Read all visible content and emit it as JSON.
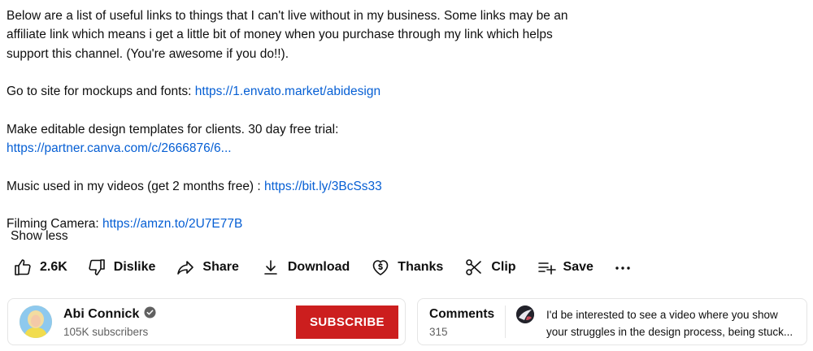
{
  "description": {
    "intro": "Below are a list of useful links to things that I can't live without in my business. Some links may be an affiliate link which means i get a little bit of money when you purchase through my link which helps support this channel. (You're awesome if you do!!).",
    "mockups_label": "Go to site for mockups and fonts: ",
    "mockups_link": "https://1.envato.market/abidesign",
    "templates_label": "Make editable design templates for clients. 30 day free trial:",
    "templates_link": "https://partner.canva.com/c/2666876/6...",
    "music_label": "Music used in my videos (get 2 months free) : ",
    "music_link": "https://bit.ly/3BcSs33",
    "camera_label": "Filming Camera: ",
    "camera_link": "https://amzn.to/2U7E77B",
    "show_less": "Show less"
  },
  "actions": {
    "like_count": "2.6K",
    "dislike": "Dislike",
    "share": "Share",
    "download": "Download",
    "thanks": "Thanks",
    "clip": "Clip",
    "save": "Save"
  },
  "channel": {
    "name": "Abi Connick",
    "subscribers": "105K subscribers",
    "subscribe_label": "SUBSCRIBE"
  },
  "comments": {
    "title": "Comments",
    "count": "315",
    "preview_line1": "I'd be interested to see a video where you show",
    "preview_line2": "your struggles in the design process, being stuck..."
  },
  "colors": {
    "link": "#065fd4",
    "subscribe_bg": "#cc1e1e",
    "secondary_text": "#606060"
  }
}
